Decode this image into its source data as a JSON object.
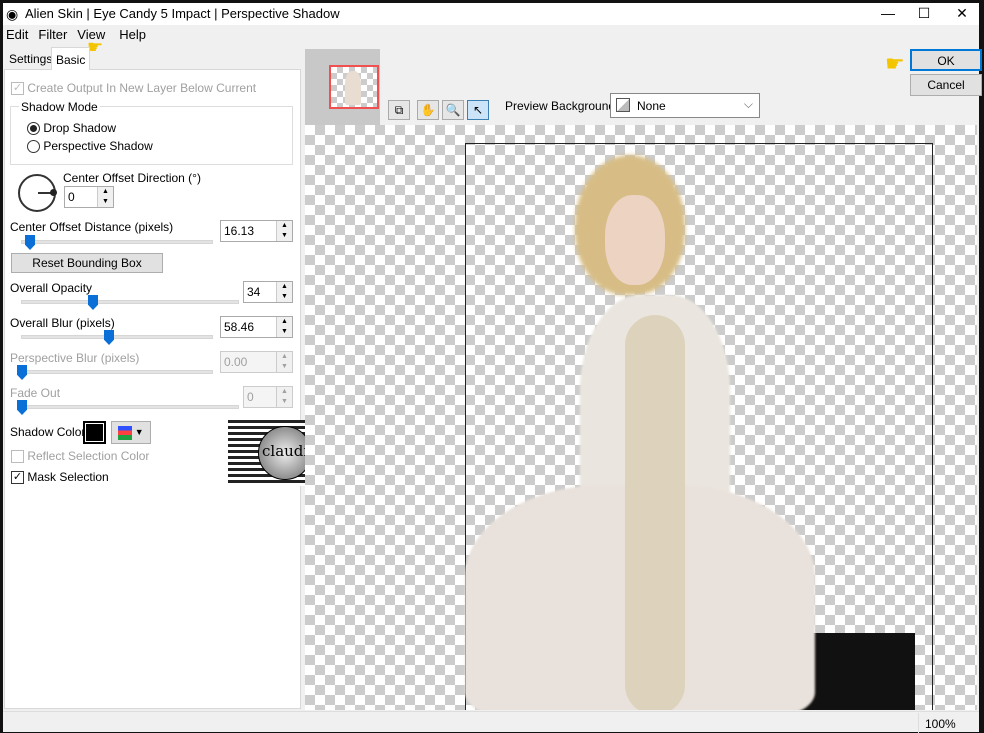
{
  "window": {
    "title": "Alien Skin | Eye Candy 5 Impact | Perspective Shadow",
    "minimize": "—",
    "maximize": "☐",
    "close": "✕"
  },
  "menu": [
    "Edit",
    "Filter",
    "View",
    "Help"
  ],
  "tabs": [
    {
      "label": "Settings",
      "active": false
    },
    {
      "label": "Basic",
      "active": true
    }
  ],
  "basic": {
    "create_output": "Create Output In New Layer Below Current",
    "shadow_mode": {
      "label": "Shadow Mode",
      "options": [
        "Drop Shadow",
        "Perspective Shadow"
      ],
      "selected": "Drop Shadow"
    },
    "direction": {
      "label": "Center Offset Direction (°)",
      "value": "0"
    },
    "distance": {
      "label": "Center Offset Distance (pixels)",
      "value": "16.13"
    },
    "reset_button": "Reset Bounding Box",
    "opacity": {
      "label": "Overall Opacity",
      "value": "34"
    },
    "blur": {
      "label": "Overall Blur (pixels)",
      "value": "58.46"
    },
    "persp_blur": {
      "label": "Perspective Blur (pixels)",
      "value": "0.00"
    },
    "fade_out": {
      "label": "Fade Out",
      "value": "0"
    },
    "shadow_color": {
      "label": "Shadow Color",
      "color": "#000000"
    },
    "reflect": {
      "label": "Reflect Selection Color",
      "checked": false
    },
    "mask": {
      "label": "Mask Selection",
      "checked": true
    },
    "watermark": "claudia"
  },
  "toolbar": {
    "preview_bg_label": "Preview Background:",
    "preview_bg_value": "None"
  },
  "buttons": {
    "ok": "OK",
    "cancel": "Cancel"
  },
  "status": {
    "zoom": "100%"
  }
}
